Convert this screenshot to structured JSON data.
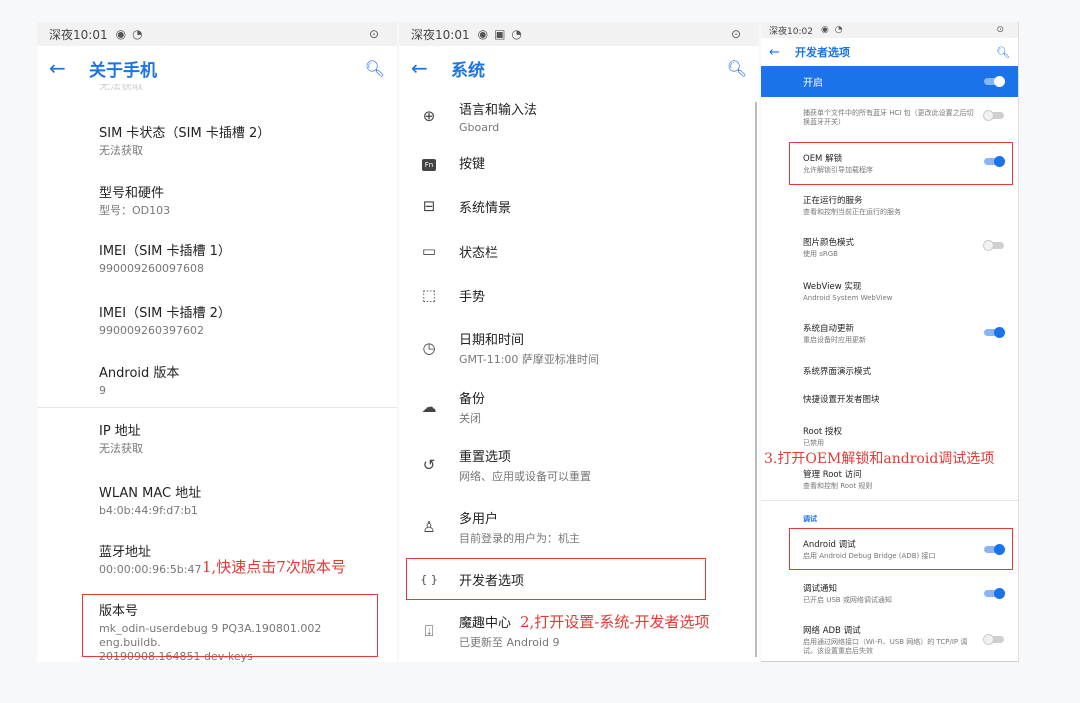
{
  "panel1": {
    "status": {
      "time": "深夜10:01"
    },
    "title": "关于手机",
    "partial_text": "无法获取",
    "items": [
      {
        "title": "SIM 卡状态（SIM 卡插槽 2）",
        "subtitle": "无法获取"
      },
      {
        "title": "型号和硬件",
        "subtitle": "型号：OD103"
      },
      {
        "title": "IMEI（SIM 卡插槽 1）",
        "subtitle": "990009260097608"
      },
      {
        "title": "IMEI（SIM 卡插槽 2）",
        "subtitle": "990009260397602"
      },
      {
        "title": "Android 版本",
        "subtitle": "9"
      },
      {
        "title": "IP 地址",
        "subtitle": "无法获取"
      },
      {
        "title": "WLAN MAC 地址",
        "subtitle": "b4:0b:44:9f:d7:b1"
      },
      {
        "title": "蓝牙地址",
        "subtitle": "00:00:00:96:5b:47"
      },
      {
        "title": "版本号",
        "subtitle": "mk_odin-userdebug 9 PQ3A.190801.002 eng.buildb.\n20190908.164851 dev-keys"
      }
    ],
    "annotation": "1,快速点击7次版本号"
  },
  "panel2": {
    "status": {
      "time": "深夜10:01"
    },
    "title": "系统",
    "items": [
      {
        "icon": "globe-icon",
        "title": "语言和输入法",
        "subtitle": "Gboard"
      },
      {
        "icon": "fn-key-icon",
        "icon_text": "Fn",
        "title": "按键",
        "subtitle": ""
      },
      {
        "icon": "system-info-icon",
        "title": "系统情景",
        "subtitle": ""
      },
      {
        "icon": "status-bar-icon",
        "title": "状态栏",
        "subtitle": ""
      },
      {
        "icon": "gesture-icon",
        "title": "手势",
        "subtitle": ""
      },
      {
        "icon": "clock-icon",
        "title": "日期和时间",
        "subtitle": "GMT-11:00 萨摩亚标准时间"
      },
      {
        "icon": "backup-icon",
        "title": "备份",
        "subtitle": "关闭"
      },
      {
        "icon": "reset-icon",
        "title": "重置选项",
        "subtitle": "网络、应用或设备可以重置"
      },
      {
        "icon": "user-icon",
        "title": "多用户",
        "subtitle": "目前登录的用户为：机主"
      },
      {
        "icon": "code-braces-icon",
        "icon_text": "{ }",
        "title": "开发者选项",
        "subtitle": ""
      },
      {
        "icon": "update-icon",
        "title": "魔趣中心",
        "subtitle": "已更新至 Android 9"
      }
    ],
    "annotation": "2,打开设置-系统-开发者选项"
  },
  "panel3": {
    "status": {
      "time": "深夜10:02"
    },
    "title": "开发者选项",
    "master_label": "开启",
    "partial_subtitle": "捕获单个文件中的所有蓝牙 HCI 包（更改此设置之后切换蓝牙开关）",
    "items": [
      {
        "title": "OEM 解锁",
        "subtitle": "允许解锁引导加载程序",
        "toggle": true
      },
      {
        "title": "正在运行的服务",
        "subtitle": "查看和控制当前正在运行的服务"
      },
      {
        "title": "图片颜色模式",
        "subtitle": "使用 sRGB",
        "toggle": false
      },
      {
        "title": "WebView 实现",
        "subtitle": "Android System WebView"
      },
      {
        "title": "系统自动更新",
        "subtitle": "重启设备时应用更新",
        "toggle": true
      },
      {
        "title": "系统界面演示模式",
        "subtitle": ""
      },
      {
        "title": "快捷设置开发者图块",
        "subtitle": ""
      },
      {
        "title": "Root 授权",
        "subtitle": "已禁用"
      },
      {
        "title": "管理 Root 访问",
        "subtitle": "查看和控制 Root 规则"
      }
    ],
    "section": "调试",
    "debug_items": [
      {
        "title": "Android 调试",
        "subtitle": "启用 Android Debug Bridge (ADB) 接口",
        "toggle": true
      },
      {
        "title": "调试通知",
        "subtitle": "已开启 USB 或网络调试通知",
        "toggle": true
      },
      {
        "title": "网络 ADB 调试",
        "subtitle": "启用通过网络接口（Wi-Fi、USB 网络）的 TCP/IP 调试。该设置重启后失效",
        "toggle": false
      }
    ],
    "annotation": "3.打开OEM解锁和android调试选项"
  }
}
